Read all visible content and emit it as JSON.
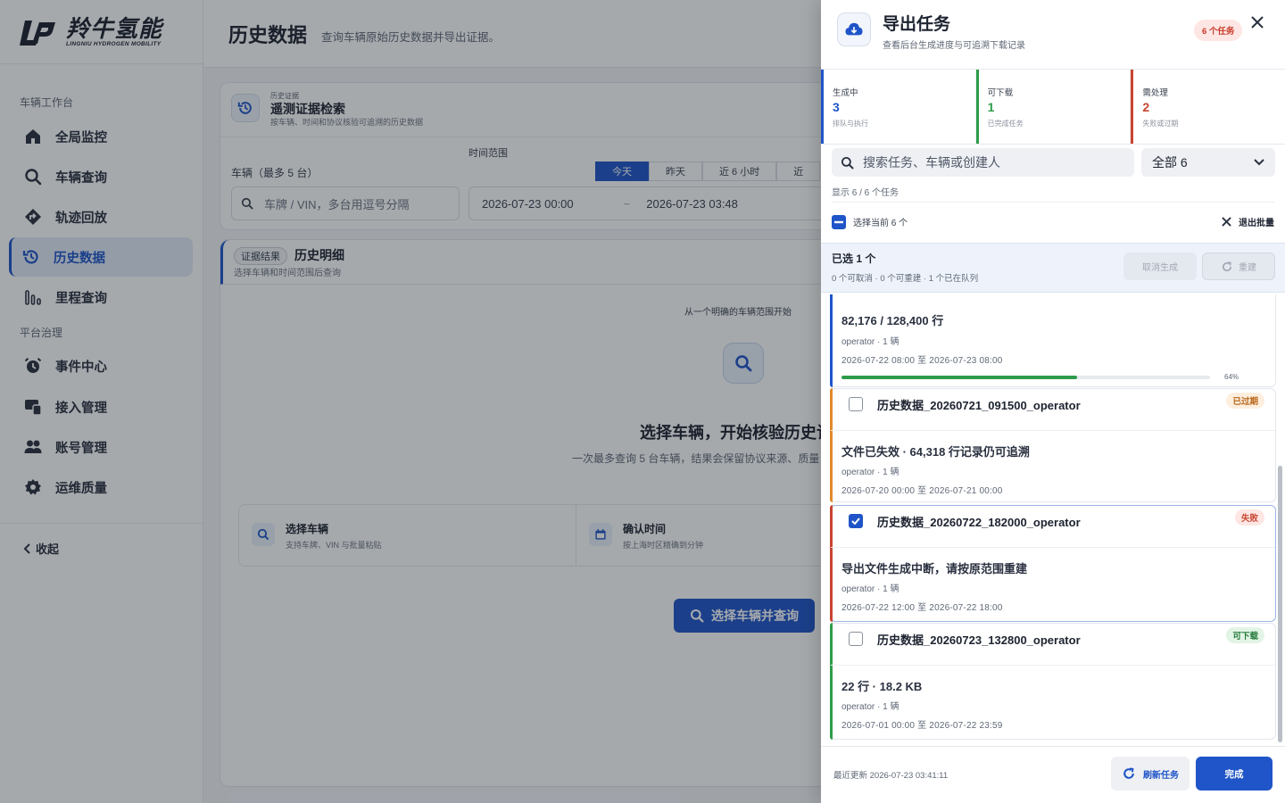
{
  "brand": {
    "name_cn": "羚牛氢能",
    "name_en": "LINGNIU HYDROGEN MOBILITY"
  },
  "sidebar": {
    "group_vehicle": "车辆工作台",
    "group_platform": "平台治理",
    "items": [
      {
        "label": "全局监控",
        "icon": "home-icon"
      },
      {
        "label": "车辆查询",
        "icon": "search-icon"
      },
      {
        "label": "轨迹回放",
        "icon": "route-icon"
      },
      {
        "label": "历史数据",
        "icon": "history-icon",
        "active": true
      },
      {
        "label": "里程查询",
        "icon": "bar-chart-icon"
      },
      {
        "label": "事件中心",
        "icon": "alarm-icon"
      },
      {
        "label": "接入管理",
        "icon": "device-icon"
      },
      {
        "label": "账号管理",
        "icon": "users-icon"
      },
      {
        "label": "运维质量",
        "icon": "gear-icon"
      }
    ],
    "collapse_label": "收起"
  },
  "header": {
    "title": "历史数据",
    "subtitle": "查询车辆原始历史数据并导出证据。"
  },
  "search_card": {
    "kicker": "历史证据",
    "title": "遥测证据检索",
    "subtitle": "按车辆、时间和协议核验可追溯的历史数据",
    "vehicle_label": "车辆（最多 5 台）",
    "vehicle_placeholder": "车牌 / VIN，多台用逗号分隔",
    "range_label": "时间范围",
    "quick_ranges": [
      "今天",
      "昨天",
      "近 6 小时",
      "近"
    ],
    "start_time": "2026-07-23 00:00",
    "range_sep": "~",
    "end_time": "2026-07-23 03:48"
  },
  "result_card": {
    "tag": "证据结果",
    "title": "历史明细",
    "subtitle": "选择车辆和时间范围后查询",
    "empty_kicker": "从一个明确的车辆范围开始",
    "empty_title": "选择车辆，开始核验历史记",
    "empty_sub": "一次最多查询 5 台车辆，结果会保留协议来源、质量",
    "steps": [
      {
        "title": "选择车辆",
        "sub": "支持车牌、VIN 与批量粘贴"
      },
      {
        "title": "确认时间",
        "sub": "按上海时区精确到分钟"
      }
    ],
    "cta": "选择车辆并查询"
  },
  "drawer": {
    "title": "导出任务",
    "subtitle": "查看后台生成进度与可追溯下载记录",
    "count_badge": "6 个任务",
    "stats": [
      {
        "label": "生成中",
        "value": "3",
        "hint": "排队与执行",
        "color": "#1f55c8"
      },
      {
        "label": "可下载",
        "value": "1",
        "hint": "已完成任务",
        "color": "#2e9c4a"
      },
      {
        "label": "需处理",
        "value": "2",
        "hint": "失败或过期",
        "color": "#c8442f"
      }
    ],
    "search_placeholder": "搜索任务、车辆或创建人",
    "filter_value": "全部 6",
    "showing_text": "显示 6 / 6 个任务",
    "select_current": "选择当前 6 个",
    "exit_batch": "退出批量",
    "batch": {
      "selected": "已选 1 个",
      "summary": "0 个可取消 · 0 个可重建 · 1 个已在队列",
      "cancel_label": "取消生成",
      "rebuild_label": "重建"
    },
    "tasks": [
      {
        "name": "",
        "metric": "82,176 / 128,400 行",
        "user": "operator · 1 辆",
        "range": "2026-07-22 08:00 至 2026-07-23 08:00",
        "progress": 0.64,
        "progress_label": "64%",
        "accent": "#1f55c8"
      },
      {
        "name": "历史数据_20260721_091500_operator",
        "badge": "已过期",
        "metric": "文件已失效 · 64,318 行记录仍可追溯",
        "user": "operator · 1 辆",
        "range": "2026-07-20 00:00 至 2026-07-21 00:00",
        "checked": false,
        "accent": "#e08a2c"
      },
      {
        "name": "历史数据_20260722_182000_operator",
        "badge": "失败",
        "metric": "导出文件生成中断，请按原范围重建",
        "user": "operator · 1 辆",
        "range": "2026-07-22 12:00 至 2026-07-22 18:00",
        "checked": true,
        "accent": "#c8442f"
      },
      {
        "name": "历史数据_20260723_132800_operator",
        "badge": "可下载",
        "metric": "22 行 · 18.2 KB",
        "user": "operator · 1 辆",
        "range": "2026-07-01 00:00 至 2026-07-22 23:59",
        "checked": false,
        "accent": "#2e9c4a"
      }
    ],
    "last_updated": "最近更新 2026-07-23 03:41:11",
    "refresh_label": "刷新任务",
    "done_label": "完成"
  }
}
